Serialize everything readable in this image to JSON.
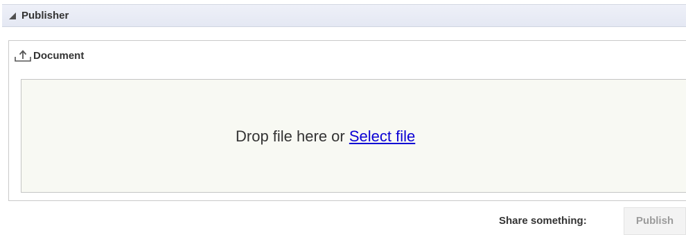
{
  "publisher": {
    "title": "Publisher",
    "toggle_icon": "collapse-triangle-icon"
  },
  "document": {
    "icon": "upload-icon",
    "label": "Document",
    "drop_text": "Drop file here or ",
    "select_link": "Select file"
  },
  "footer": {
    "share_label": "Share something:",
    "publish_button": "Publish"
  },
  "colors": {
    "header_bg": "#e6e9f4",
    "dropzone_bg": "#f8f9f3",
    "link": "#0b00d4",
    "disabled_text": "#9b9b9b"
  }
}
